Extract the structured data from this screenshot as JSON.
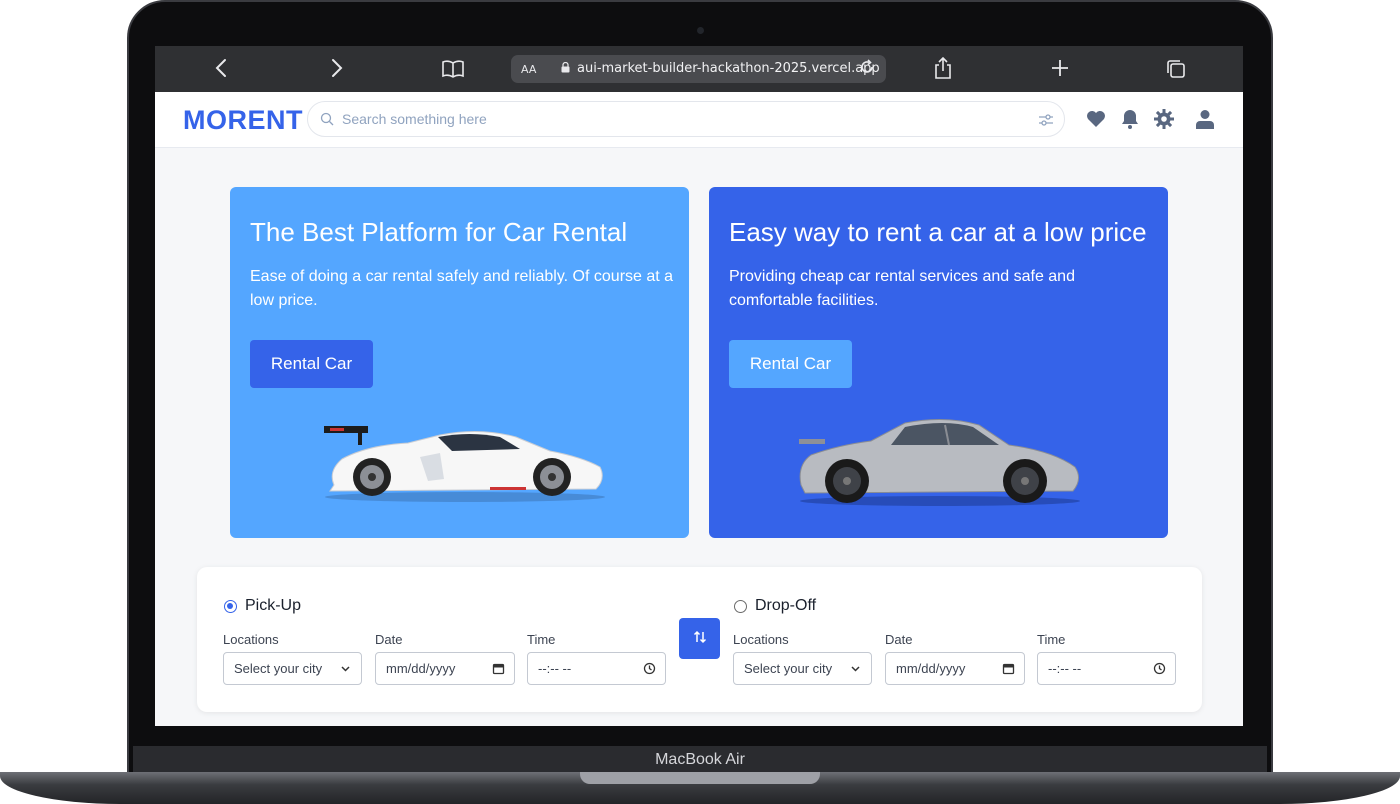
{
  "device": {
    "label": "MacBook Air"
  },
  "browser": {
    "url_aa": "AA",
    "url": "aui-market-builder-hackathon-2025.vercel.app"
  },
  "header": {
    "logo": "MORENT",
    "search_placeholder": "Search something here",
    "icons": [
      "heart-icon",
      "bell-icon",
      "gear-icon",
      "user-icon"
    ]
  },
  "hero": [
    {
      "title": "The Best Platform for Car Rental",
      "text": "Ease of doing a car rental safely and reliably. Of course at a low price.",
      "button": "Rental Car",
      "color": "#54a6ff"
    },
    {
      "title": "Easy way to rent a car at a low price",
      "text": "Providing cheap car rental services and safe and comfortable facilities.",
      "button": "Rental Car",
      "color": "#3563e9"
    }
  ],
  "booking": {
    "pickup": {
      "label": "Pick-Up",
      "selected": true,
      "locations_label": "Locations",
      "locations_value": "Select your city",
      "date_label": "Date",
      "date_value": "mm/dd/yyyy",
      "time_label": "Time",
      "time_value": "--:-- --"
    },
    "dropoff": {
      "label": "Drop-Off",
      "selected": false,
      "locations_label": "Locations",
      "locations_value": "Select your city",
      "date_label": "Date",
      "date_value": "mm/dd/yyyy",
      "time_label": "Time",
      "time_value": "--:-- --"
    }
  },
  "colors": {
    "brand": "#3563e9",
    "accent_light": "#54a6ff"
  }
}
